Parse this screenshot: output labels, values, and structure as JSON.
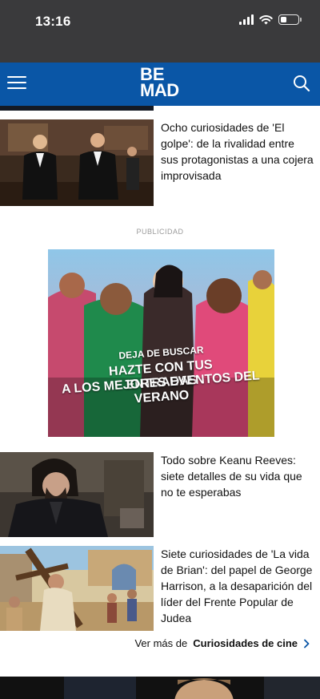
{
  "status_bar": {
    "time": "13:16",
    "battery_level": 0.35
  },
  "header": {
    "logo_line1": "BE",
    "logo_line2": "MAD",
    "brand_color": "#0a56a6"
  },
  "icons": {
    "menu": "hamburger-menu-icon",
    "search": "search-icon",
    "chevron": "chevron-right-icon"
  },
  "articles": [
    {
      "title": "Ocho curiosidades de 'El golpe': de la rivalidad entre sus protagonistas a una cojera improvisada"
    },
    {
      "title": "Todo sobre Keanu Reeves: siete detalles de su vida que no te esperabas"
    },
    {
      "title": "Siete curiosidades de 'La vida de Brian': del papel de George Harrison, a la desaparición del líder del Frente Popular de Judea"
    }
  ],
  "ad": {
    "label": "PUBLICIDAD",
    "line1": "DEJA DE BUSCAR",
    "line2": "HAZTE CON TUS ENTRADAS",
    "line3": "A LOS MEJORES EVENTOS DEL VERANO"
  },
  "see_more": {
    "prefix": "Ver más de",
    "section": "Curiosidades de cine"
  }
}
